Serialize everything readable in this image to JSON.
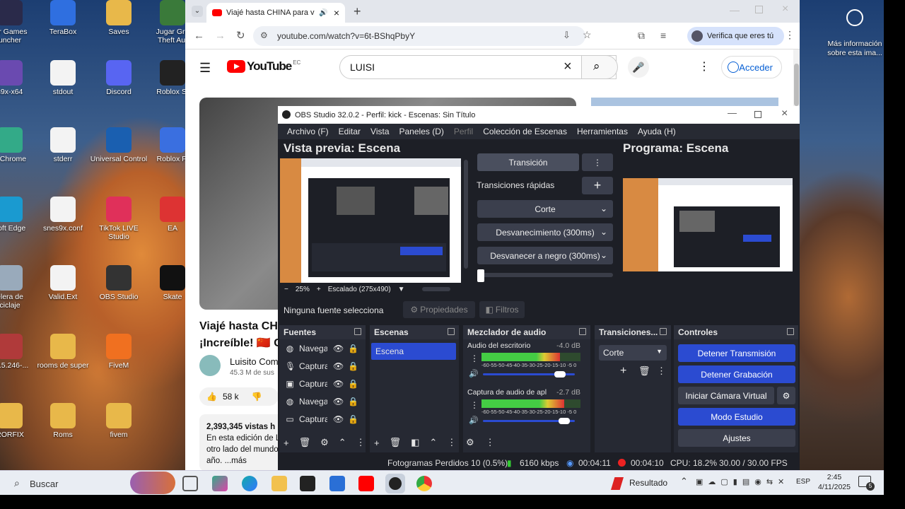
{
  "desktop": {
    "icons": [
      {
        "label": "tar Games\nuncher",
        "icon": "game-launcher-icon"
      },
      {
        "label": "TeraBox",
        "icon": "terabox-icon"
      },
      {
        "label": "Saves",
        "icon": "folder-icon"
      },
      {
        "label": "Jugar Gra\nTheft Aut",
        "icon": "gta-icon"
      },
      {
        "label": "s9x-x64",
        "icon": "snes9x-icon"
      },
      {
        "label": "stdout",
        "icon": "file-icon"
      },
      {
        "label": "Discord",
        "icon": "discord-icon"
      },
      {
        "label": "Roblox St",
        "icon": "roblox-studio-icon"
      },
      {
        "label": "e Chrome",
        "icon": "chrome-icon"
      },
      {
        "label": "stderr",
        "icon": "file-icon"
      },
      {
        "label": "Universal Control",
        "icon": "universal-control-icon"
      },
      {
        "label": "Roblox Pl",
        "icon": "roblox-player-icon"
      },
      {
        "label": "soft Edge",
        "icon": "edge-icon"
      },
      {
        "label": "snes9x.conf",
        "icon": "file-icon"
      },
      {
        "label": "TikTok LIVE\nStudio",
        "icon": "tiktok-live-icon"
      },
      {
        "label": "EA",
        "icon": "ea-icon"
      },
      {
        "label": "elera de\nciclaje",
        "icon": "recycle-bin-icon"
      },
      {
        "label": "Valid.Ext",
        "icon": "file-icon"
      },
      {
        "label": "OBS Studio",
        "icon": "obs-icon"
      },
      {
        "label": "Skate",
        "icon": "skate-icon"
      },
      {
        "label": "v2.5.246-...",
        "icon": "archive-icon"
      },
      {
        "label": "rooms de super",
        "icon": "folder-icon"
      },
      {
        "label": "FiveM",
        "icon": "fivem-icon"
      },
      {
        "label": "RORFIX",
        "icon": "folder-icon"
      },
      {
        "label": "Roms",
        "icon": "folder-icon"
      },
      {
        "label": "fivem",
        "icon": "folder-icon"
      }
    ],
    "edge_info": "Más información\nsobre esta ima..."
  },
  "browser": {
    "tab_title": "Viajé hasta CHINA para ver",
    "url": "youtube.com/watch?v=6t-BShqPbyY",
    "profile_btn": "Verifica que eres tú"
  },
  "youtube": {
    "logo": "YouTube",
    "region": "EC",
    "search_value": "LUISI",
    "signin": "Acceder",
    "video_title_1": "Viajé hasta CH",
    "video_title_2": "¡Increíble! 🇨🇳 CN",
    "channel": "Luisito Com",
    "subs": "45.3 M de sus",
    "likes": "58 k",
    "views": "2,393,345 vistas  h",
    "desc_1": "En esta edición de L",
    "desc_2": "otro lado del mundo",
    "desc_3": "año.  ...más"
  },
  "obs": {
    "title": "OBS Studio 32.0.2 - Perfil: kick - Escenas: Sin Título",
    "menu": [
      "Archivo (F)",
      "Editar",
      "Vista",
      "Paneles (D)",
      "Perfil",
      "Colección de Escenas",
      "Herramientas",
      "Ayuda (H)"
    ],
    "preview_title": "Vista previa: Escena",
    "program_title": "Programa: Escena",
    "transition_btn": "Transición",
    "quick_transitions": "Transiciones rápidas",
    "quick_list": [
      "Corte",
      "Desvanecimiento (300ms)",
      "Desvanecer a negro (300ms)"
    ],
    "zoom": "25%",
    "scaling": "Escalado (275x490)",
    "no_source": "Ninguna fuente selecciona",
    "properties": "Propiedades",
    "filters": "Filtros",
    "docks": {
      "sources": "Fuentes",
      "scenes": "Escenas",
      "mixer": "Mezclador de audio",
      "transitions": "Transiciones...",
      "controls": "Controles"
    },
    "sources": [
      "Navega",
      "Captura",
      "Captura",
      "Navega",
      "Captura"
    ],
    "scene": "Escena",
    "mixer": [
      {
        "name": "Audio del escritorio",
        "db": "-4.0 dB",
        "level": 0.85
      },
      {
        "name": "Captura de audio de aplicació",
        "db": "-2.7 dB",
        "level": 0.9
      }
    ],
    "meter_ticks": "-60-55-50-45-40-35-30-25-20-15-10 -5  0",
    "transition_select": "Corte",
    "controls": {
      "stop_stream": "Detener Transmisión",
      "stop_record": "Detener Grabación",
      "virtual_cam": "Iniciar Cámara Virtual",
      "studio_mode": "Modo Estudio",
      "settings": "Ajustes"
    },
    "status": {
      "dropped": "Fotogramas Perdidos 10 (0.5%)",
      "kbps": "6160 kbps",
      "stream_time": "00:04:11",
      "rec_time": "00:04:10",
      "cpu": "CPU: 18.2%",
      "fps": "30.00 / 30.00 FPS"
    }
  },
  "taskbar": {
    "search": "Buscar",
    "weather": "Resultado",
    "lang": "ESP",
    "time": "2:45",
    "date": "4/11/2025",
    "notif_count": "5"
  },
  "colors": {
    "obs_blue": "#2b4bd1",
    "yt_red": "#ff0000",
    "obs_bg": "#1d1f26"
  }
}
